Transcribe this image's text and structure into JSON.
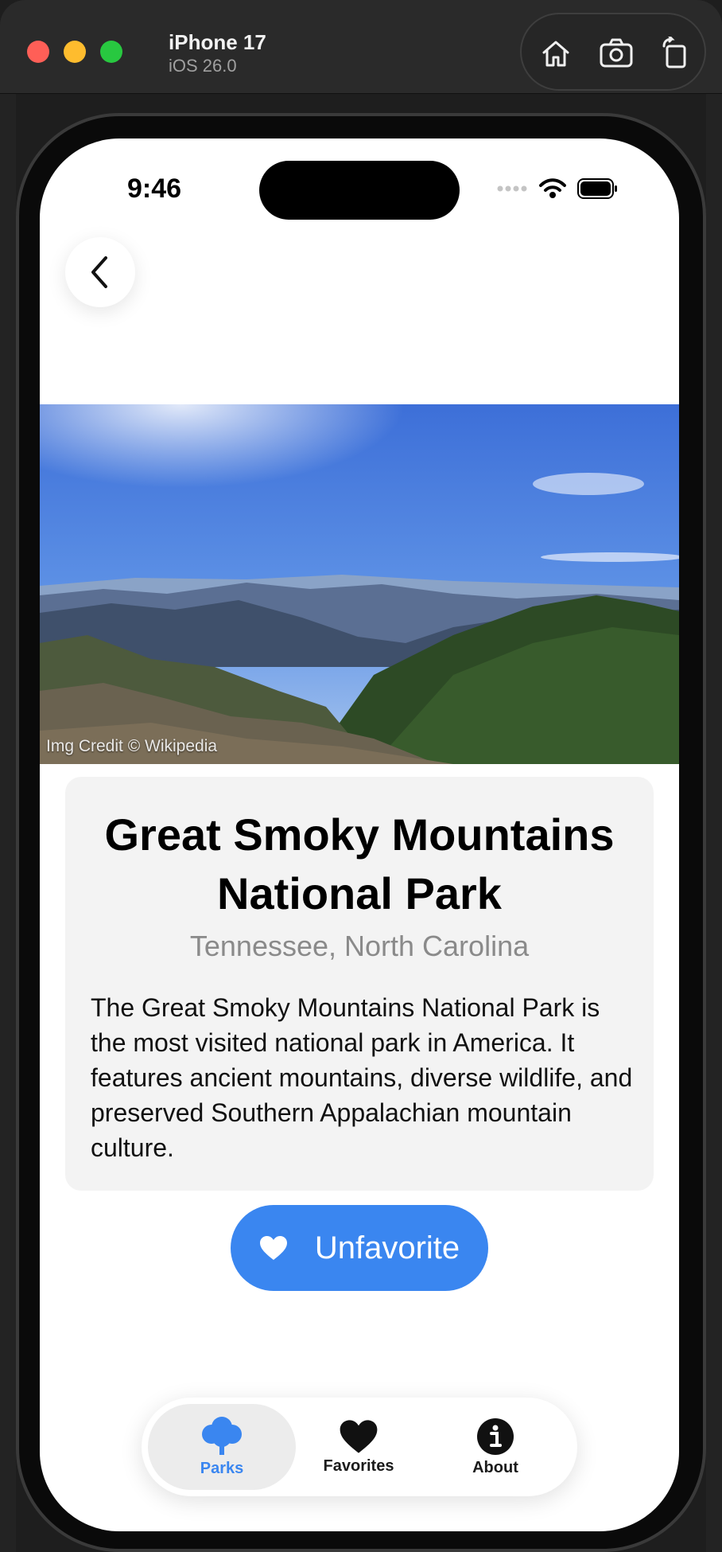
{
  "simulator": {
    "device_name": "iPhone 17",
    "os_version": "iOS 26.0",
    "controls": [
      "home-icon",
      "screenshot-icon",
      "rotate-icon"
    ]
  },
  "status_bar": {
    "time": "9:46",
    "icons": [
      "cellular-icon",
      "wifi-icon",
      "battery-icon"
    ]
  },
  "navigation": {
    "back_icon": "chevron-left-icon"
  },
  "hero": {
    "image_credit": "Img Credit © Wikipedia"
  },
  "park": {
    "name": "Great Smoky Mountains National Park",
    "states": "Tennessee, North Carolina",
    "description": "The Great Smoky Mountains National Park is the most visited national park in America. It features ancient mountains, diverse wildlife, and preserved Southern Appalachian mountain culture."
  },
  "favorite_button": {
    "label": "Unfavorite",
    "icon": "heart-icon"
  },
  "tab_bar": {
    "items": [
      {
        "label": "Parks",
        "icon": "tree-icon",
        "active": true
      },
      {
        "label": "Favorites",
        "icon": "heart-icon",
        "active": false
      },
      {
        "label": "About",
        "icon": "info-icon",
        "active": false
      }
    ]
  },
  "colors": {
    "accent": "#3a86f0",
    "card_background": "#f3f3f3",
    "secondary_text": "#8a8a8a"
  }
}
